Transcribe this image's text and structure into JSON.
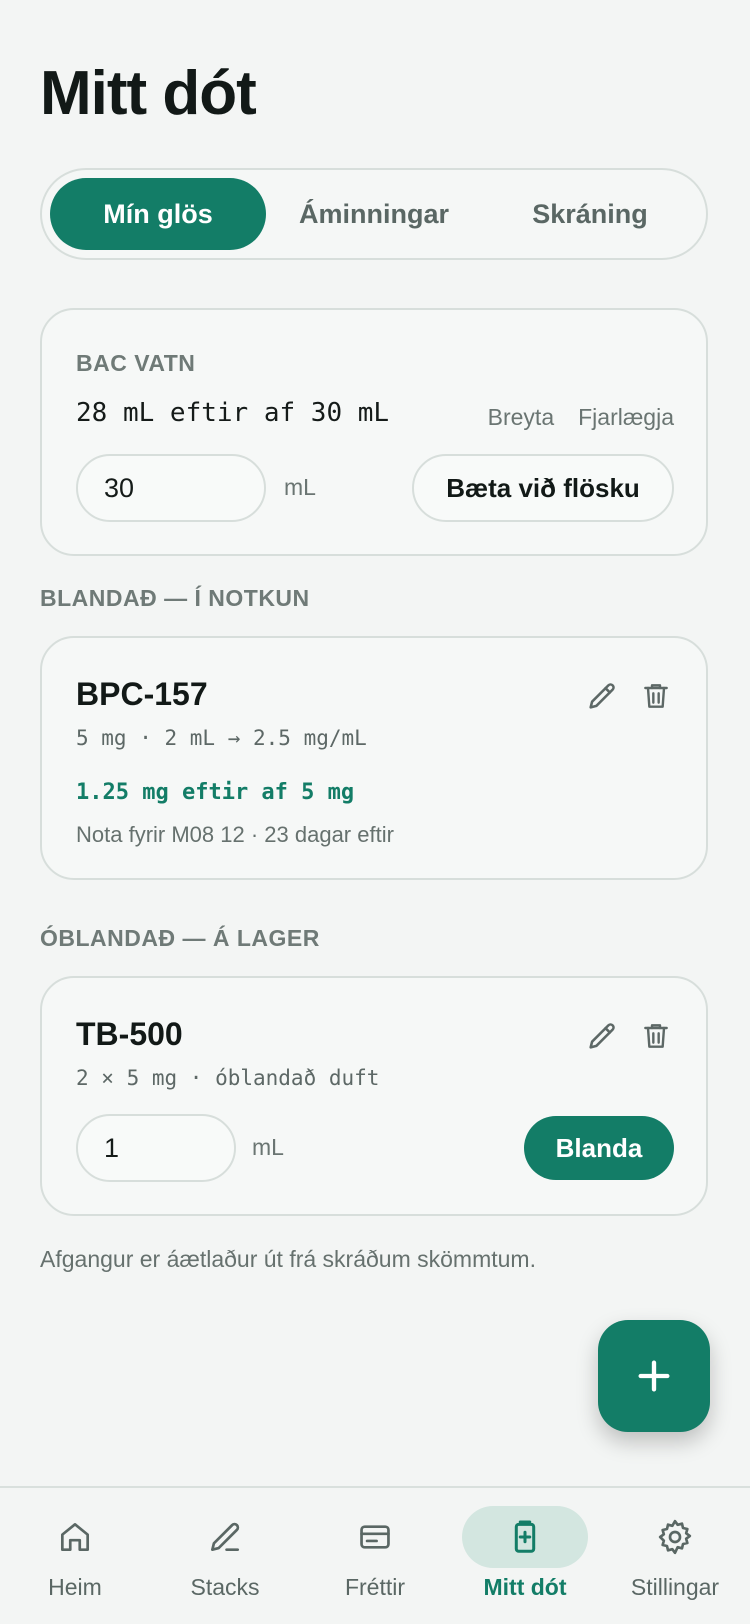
{
  "page": {
    "title": "Mitt dót"
  },
  "tabs": [
    {
      "label": "Mín glös",
      "active": true
    },
    {
      "label": "Áminningar",
      "active": false
    },
    {
      "label": "Skráning",
      "active": false
    }
  ],
  "bac_water": {
    "overline": "BAC VATN",
    "remaining": "28 mL eftir af 30 mL",
    "edit_label": "Breyta",
    "remove_label": "Fjarlægja",
    "input_value": "30",
    "unit": "mL",
    "add_button": "Bæta við flösku"
  },
  "mixed_section": {
    "heading": "BLANDAÐ — Í NOTKUN",
    "vial": {
      "name": "BPC-157",
      "spec": "5 mg · 2 mL → 2.5 mg/mL",
      "remaining": "1.25 mg eftir af 5 mg",
      "use_by": "Nota fyrir M08 12 · 23 dagar eftir"
    }
  },
  "unmixed_section": {
    "heading": "ÓBLANDAÐ — Á LAGER",
    "vial": {
      "name": "TB-500",
      "spec": "2 × 5 mg · óblandað duft",
      "input_value": "1",
      "unit": "mL",
      "mix_button": "Blanda"
    }
  },
  "footnote": "Afgangur er áætlaður út frá skráðum skömmtum.",
  "fab": {
    "icon": "plus-icon"
  },
  "nav": [
    {
      "label": "Heim",
      "icon": "home-icon",
      "active": false
    },
    {
      "label": "Stacks",
      "icon": "pencil-icon",
      "active": false
    },
    {
      "label": "Fréttir",
      "icon": "card-icon",
      "active": false
    },
    {
      "label": "Mitt dót",
      "icon": "vial-icon",
      "active": true
    },
    {
      "label": "Stillingar",
      "icon": "gear-icon",
      "active": false
    }
  ],
  "colors": {
    "accent": "#137d67",
    "accent_soft": "#d3e6e0",
    "background": "#f3f5f4",
    "border": "#d7dedb"
  }
}
